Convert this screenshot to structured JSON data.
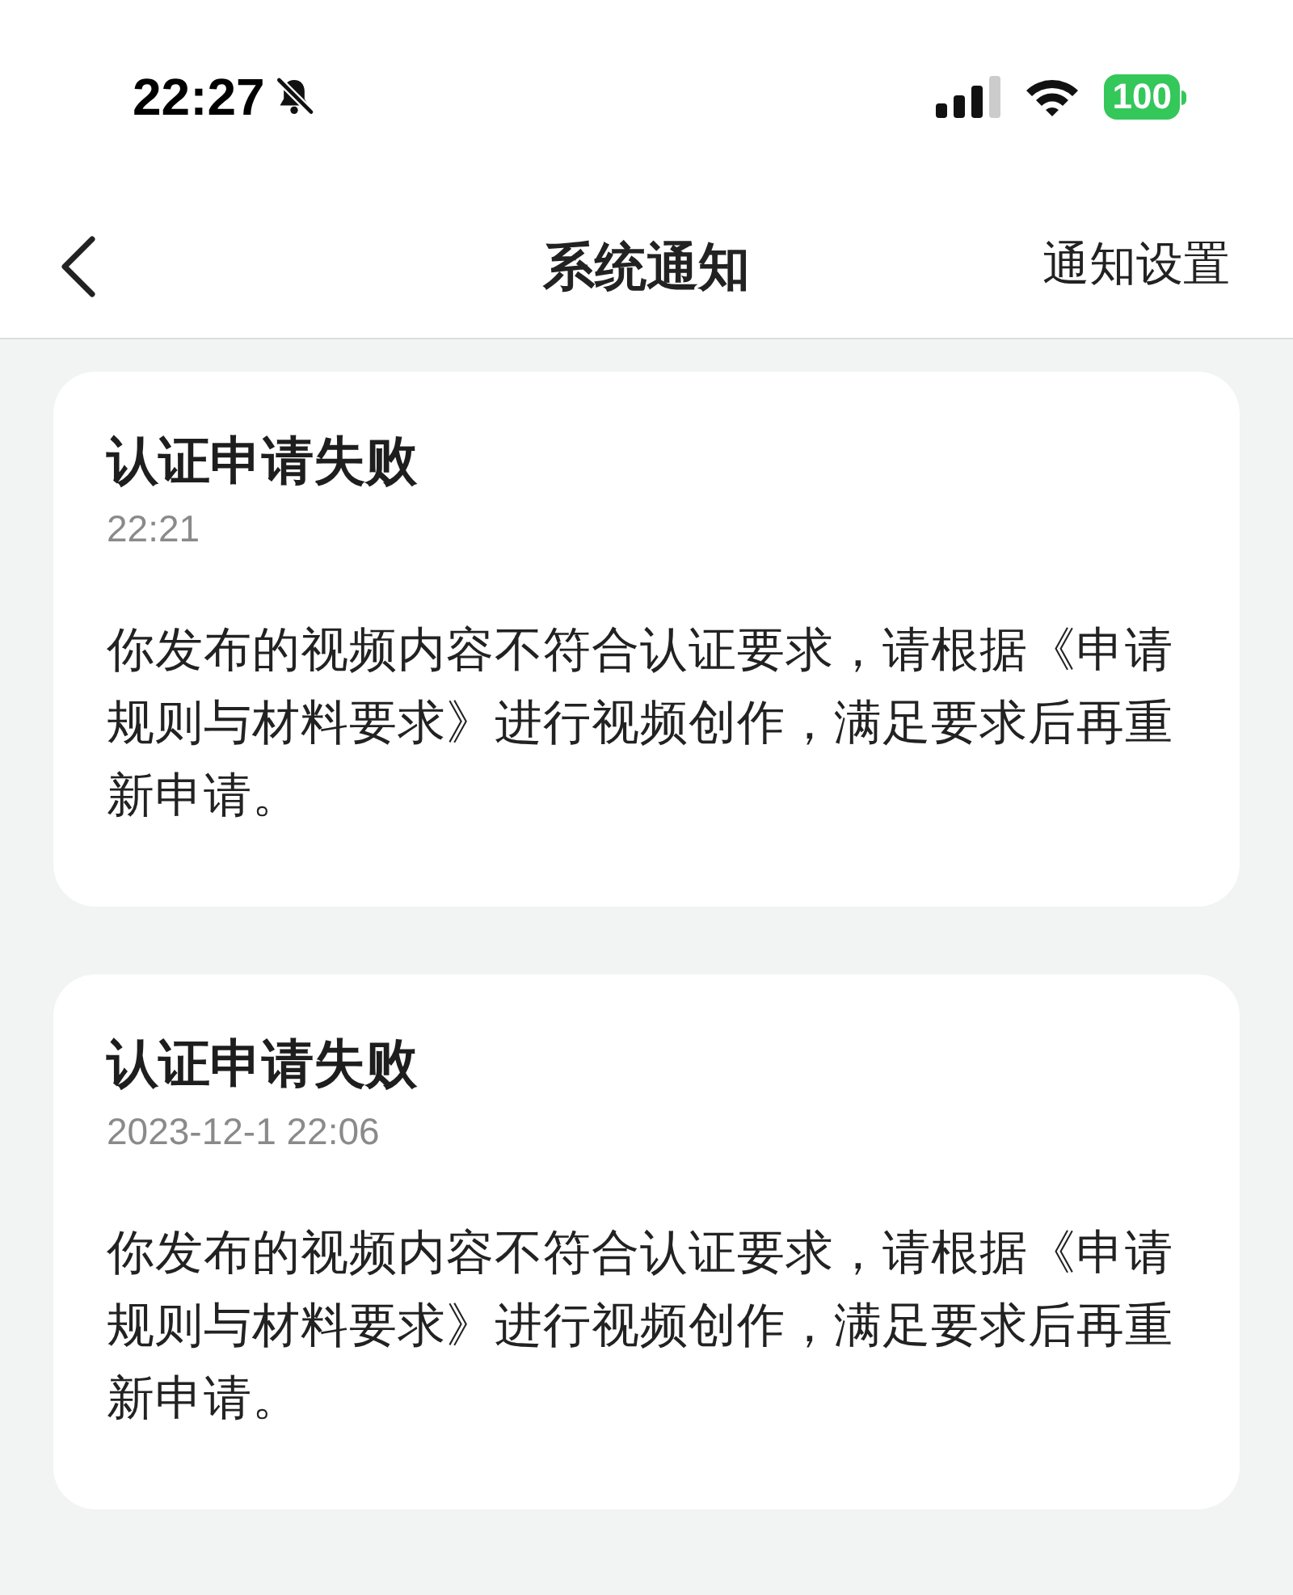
{
  "status_bar": {
    "time": "22:27",
    "battery": "100"
  },
  "nav": {
    "title": "系统通知",
    "action": "通知设置"
  },
  "notifications": [
    {
      "title": "认证申请失败",
      "time": "22:21",
      "body": "你发布的视频内容不符合认证要求，请根据《申请规则与材料要求》进行视频创作，满足要求后再重新申请。"
    },
    {
      "title": "认证申请失败",
      "time": "2023-12-1 22:06",
      "body": "你发布的视频内容不符合认证要求，请根据《申请规则与材料要求》进行视频创作，满足要求后再重新申请。"
    }
  ]
}
